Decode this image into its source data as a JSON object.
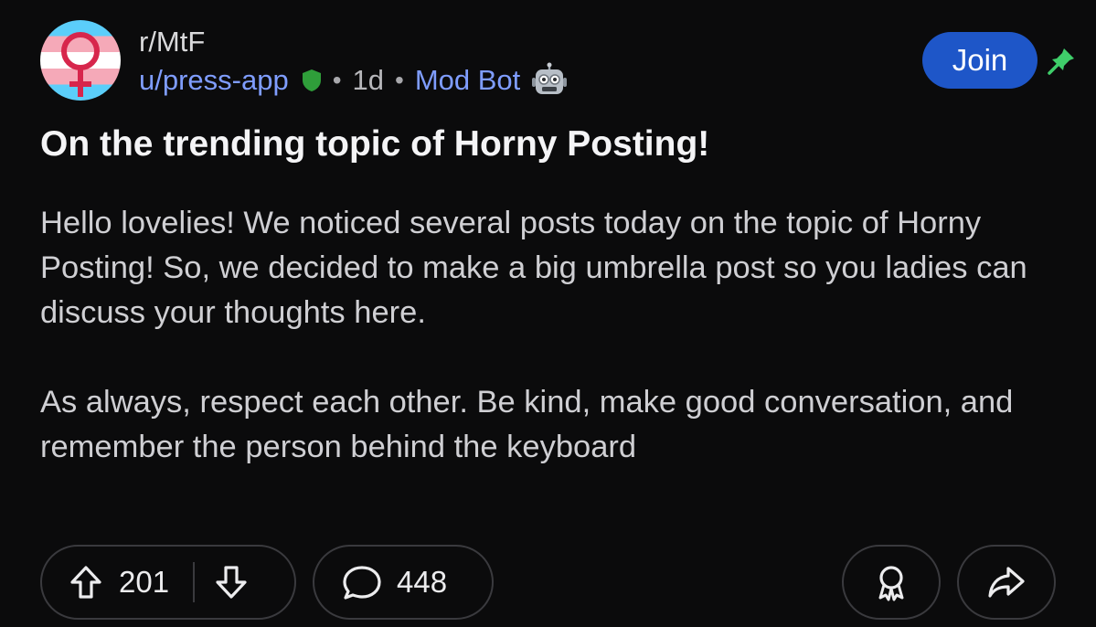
{
  "post": {
    "subreddit": "r/MtF",
    "author": "u/press-app",
    "separator": "•",
    "age": "1d",
    "flair": "Mod Bot",
    "join_label": "Join",
    "title": "On the trending topic of Horny Posting!",
    "body": [
      "Hello lovelies! We noticed several posts today on the topic of Horny Posting! So, we decided to make a big umbrella post so you ladies can discuss your thoughts here.",
      "As always, respect each other. Be kind, make good conversation, and remember the person behind the keyboard"
    ]
  },
  "actions": {
    "upvotes": "201",
    "comments": "448"
  },
  "colors": {
    "background": "#0b0b0c",
    "link": "#7f9dff",
    "join_button": "#1e56c8",
    "mod_shield": "#2f9e3a",
    "pin": "#3fce6a",
    "avatar_blue": "#5bcefa",
    "avatar_pink": "#f5a9b8"
  },
  "icons": {
    "avatar": "trans-flag-venus-avatar",
    "mod": "shield-icon",
    "flair": "robot-icon",
    "pin": "pin-icon",
    "upvote": "arrow-up-icon",
    "downvote": "arrow-down-icon",
    "comment": "speech-bubble-icon",
    "award": "award-icon",
    "share": "share-arrow-icon"
  }
}
